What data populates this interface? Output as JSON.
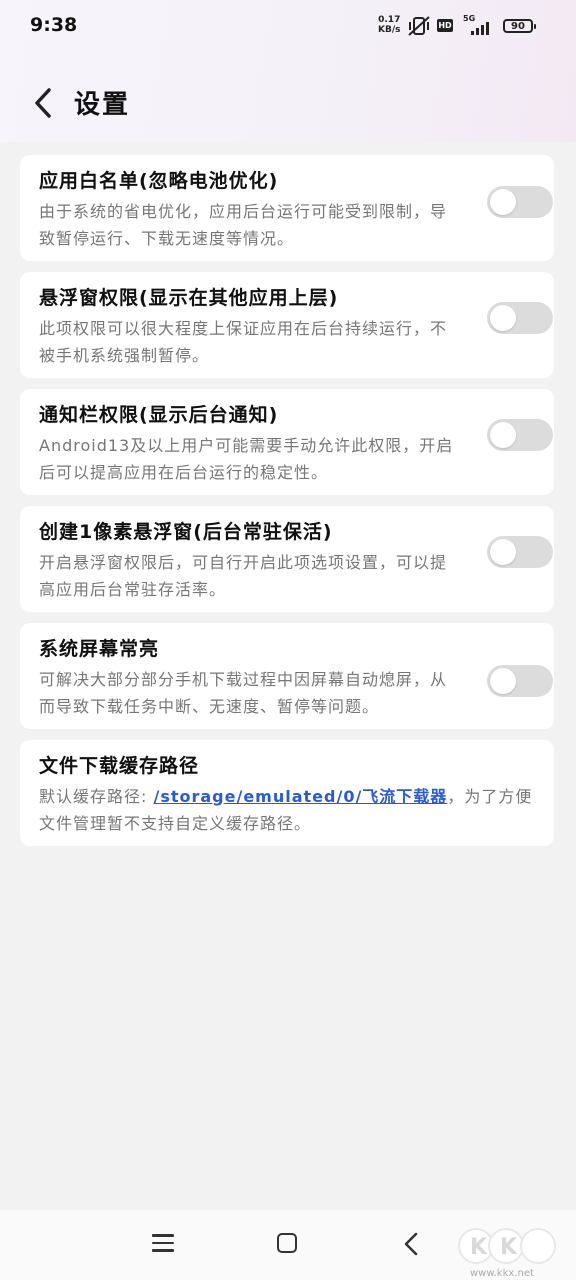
{
  "status_bar": {
    "time": "9:38",
    "net_speed_value": "0.17",
    "net_speed_unit": "KB/s",
    "hd": "HD",
    "network": "5G",
    "battery": "90"
  },
  "header": {
    "title": "设置"
  },
  "settings": [
    {
      "title": "应用白名单(忽略电池优化)",
      "description": "由于系统的省电优化，应用后台运行可能受到限制，导致暂停运行、下载无速度等情况。",
      "enabled": false
    },
    {
      "title": "悬浮窗权限(显示在其他应用上层)",
      "description": "此项权限可以很大程度上保证应用在后台持续运行，不被手机系统强制暂停。",
      "enabled": false
    },
    {
      "title": "通知栏权限(显示后台通知)",
      "description": "Android13及以上用户可能需要手动允许此权限，开启后可以提高应用在后台运行的稳定性。",
      "enabled": false
    },
    {
      "title": "创建1像素悬浮窗(后台常驻保活)",
      "description": "开启悬浮窗权限后，可自行开启此项选项设置，可以提高应用后台常驻存活率。",
      "enabled": false
    },
    {
      "title": "系统屏幕常亮",
      "description": "可解决大部分部分手机下载过程中因屏幕自动熄屏，从而导致下载任务中断、无速度、暂停等问题。",
      "enabled": false
    }
  ],
  "cache_path": {
    "title": "文件下载缓存路径",
    "prefix": "默认缓存路径: ",
    "path": "/storage/emulated/0/飞流下载器",
    "suffix": "，为了方便文件管理暂不支持自定义缓存路径。"
  },
  "watermark": {
    "brand": "KK下载",
    "url": "www.kkx.net"
  },
  "colors": {
    "link": "#2a5bd7",
    "toggle_off": "#dcdcdc",
    "card_bg": "#ffffff",
    "page_bg": "#f2f2f2"
  }
}
